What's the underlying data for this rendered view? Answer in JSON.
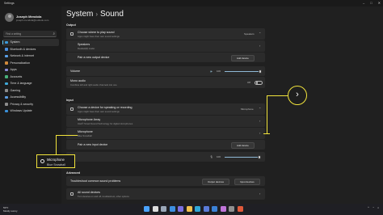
{
  "window": {
    "title": "Settings",
    "min_icon": "minimize-icon",
    "max_icon": "maximize-icon",
    "close_icon": "close-icon"
  },
  "sidebar": {
    "user_name": "Joseph Mendola",
    "user_email": "joseph.mendola@outlook.com",
    "search_placeholder": "Find a setting",
    "items": [
      {
        "label": "System",
        "icon": "monitor-icon",
        "color": "#3a9bdc",
        "active": true
      },
      {
        "label": "Bluetooth & devices",
        "icon": "bluetooth-icon",
        "color": "#4a8fe0"
      },
      {
        "label": "Network & internet",
        "icon": "wifi-icon",
        "color": "#5aa0e8"
      },
      {
        "label": "Personalization",
        "icon": "brush-icon",
        "color": "#d08a3c"
      },
      {
        "label": "Apps",
        "icon": "apps-icon",
        "color": "#8a8ad8"
      },
      {
        "label": "Accounts",
        "icon": "person-icon",
        "color": "#48b07a"
      },
      {
        "label": "Time & language",
        "icon": "globe-clock-icon",
        "color": "#3fa9d8"
      },
      {
        "label": "Gaming",
        "icon": "gamepad-icon",
        "color": "#8b8b8b"
      },
      {
        "label": "Accessibility",
        "icon": "accessibility-icon",
        "color": "#5b9be0"
      },
      {
        "label": "Privacy & security",
        "icon": "shield-icon",
        "color": "#8c8c8c"
      },
      {
        "label": "Windows Update",
        "icon": "update-icon",
        "color": "#3a8fd8"
      }
    ]
  },
  "main": {
    "breadcrumb_parent": "System",
    "breadcrumb_sep": "›",
    "page_title": "Sound",
    "output_header": "Output",
    "output_choose_title": "Choose where to play sound",
    "output_choose_sub": "Apps might have their own sound settings",
    "output_choose_value": "Speakers",
    "speakers_title": "Speakers",
    "speakers_sub": "Realtek(R) Audio",
    "pair_output_label": "Pair a new output device",
    "add_device_label": "Add device",
    "volume_label": "Volume",
    "volume_value": "100",
    "volume_level": 1.0,
    "mono_title": "Mono audio",
    "mono_sub": "Combine left and right audio channels into one",
    "mono_state": "Off",
    "input_header": "Input",
    "input_choose_title": "Choose a device for speaking or recording",
    "input_choose_sub": "Apps might have their own sound settings",
    "input_choose_value": "Microphone",
    "mic_array_title": "Microphone Array",
    "mic_array_sub": "Intel® Smart Sound Technology for digital microphones",
    "mic_title": "Microphone",
    "mic_sub": "Blue Snowball",
    "pair_input_label": "Pair a new input device",
    "add_device_input_label": "Add device",
    "input_volume_value": "100",
    "input_volume_level": 0.98,
    "advanced_header": "Advanced",
    "troubleshoot_label": "Troubleshoot common sound problems",
    "output_devices_btn": "Output devices",
    "input_devices_btn": "Input devices",
    "all_devices_label": "All sound devices",
    "all_devices_sub": "Turn devices on and off, troubleshoot, other options"
  },
  "annotation": {
    "callout_arrow": "›",
    "highlight_title": "Microphone",
    "highlight_sub": "Blue Snowball",
    "accent": "#f2e43c"
  },
  "taskbar": {
    "weather_temp": "53°F",
    "weather_desc": "Mostly sunny",
    "pinned_icons": [
      "start-icon",
      "search-icon",
      "task-view-icon",
      "widgets-icon",
      "chat-icon",
      "file-explorer-icon",
      "edge-icon",
      "store-icon",
      "mail-icon",
      "photos-icon",
      "settings-icon",
      "office-icon"
    ],
    "tray_chevron": "^"
  }
}
